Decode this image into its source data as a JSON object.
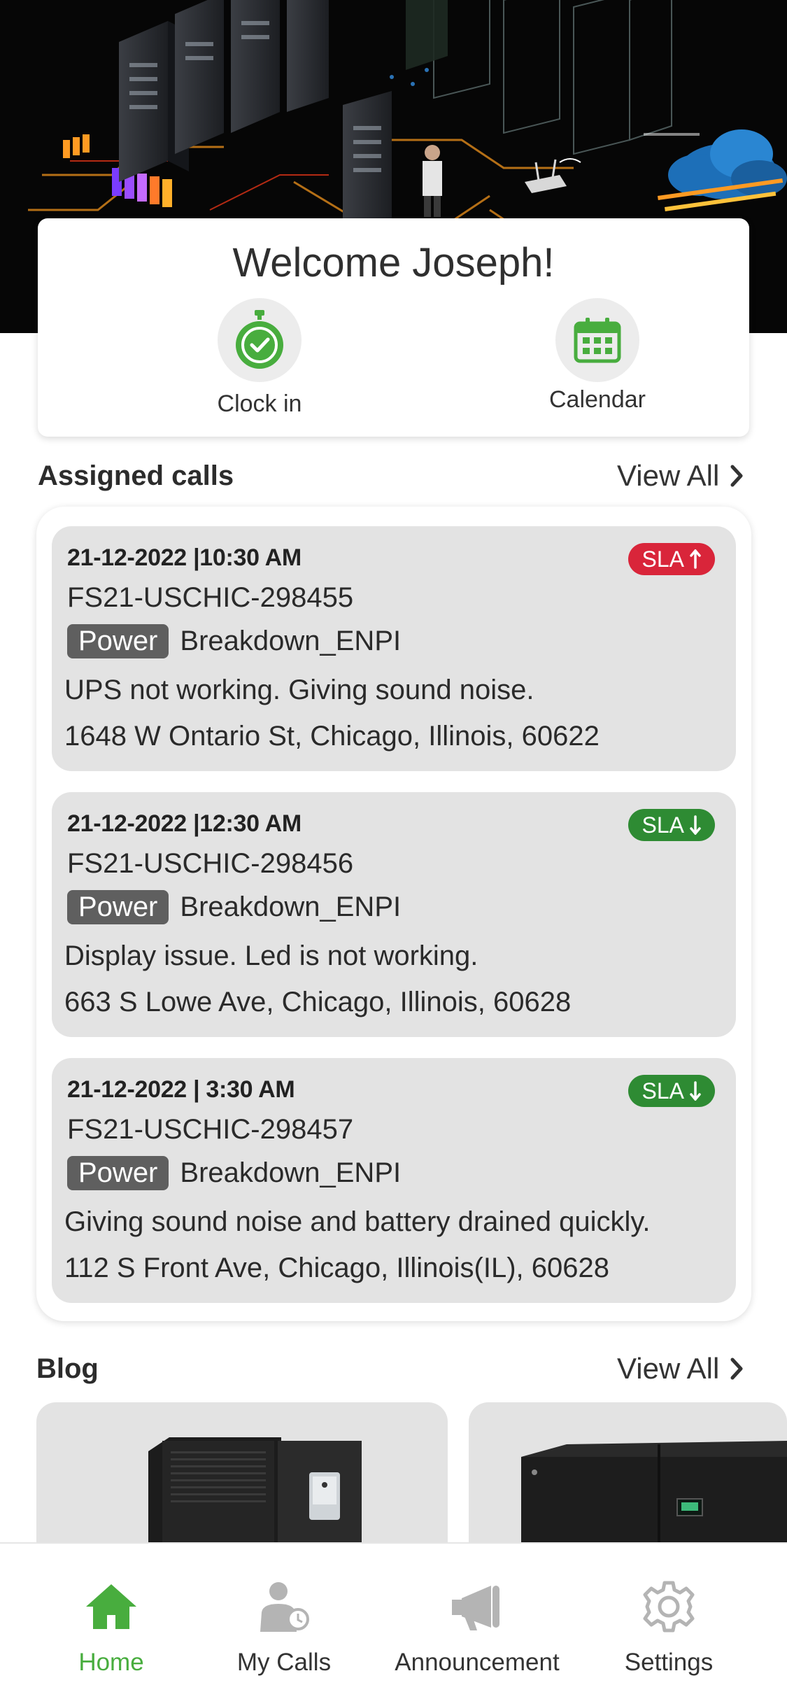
{
  "welcome": {
    "title": "Welcome Joseph!",
    "actions": [
      {
        "label": "Clock in",
        "icon": "stopwatch-check-icon"
      },
      {
        "label": "Calendar",
        "icon": "calendar-icon"
      }
    ]
  },
  "assigned_calls": {
    "title": "Assigned calls",
    "view_all": "View All",
    "calls": [
      {
        "datetime": "21-12-2022 |10:30 AM",
        "id": "FS21-USCHIC-298455",
        "type": "Power",
        "category": "Breakdown_ENPI",
        "description": "UPS not working. Giving sound noise.",
        "address": "1648 W Ontario St, Chicago, Illinois, 60622",
        "sla": "SLA",
        "sla_direction": "up",
        "sla_color": "#d9253a"
      },
      {
        "datetime": "21-12-2022 |12:30 AM",
        "id": "FS21-USCHIC-298456",
        "type": "Power",
        "category": "Breakdown_ENPI",
        "description": "Display issue. Led is not working.",
        "address": "663 S Lowe Ave, Chicago, Illinois, 60628",
        "sla": "SLA",
        "sla_direction": "down",
        "sla_color": "#2e8b33"
      },
      {
        "datetime": "21-12-2022 | 3:30 AM",
        "id": "FS21-USCHIC-298457",
        "type": "Power",
        "category": "Breakdown_ENPI",
        "description": "Giving sound noise and battery drained quickly.",
        "address": "112 S Front Ave, Chicago, Illinois(IL), 60628",
        "sla": "SLA",
        "sla_direction": "down",
        "sla_color": "#2e8b33"
      }
    ]
  },
  "blog": {
    "title": "Blog",
    "view_all": "View All"
  },
  "bottom_nav": [
    {
      "label": "Home",
      "icon": "home-icon",
      "active": true
    },
    {
      "label": "My Calls",
      "icon": "technician-clock-icon",
      "active": false
    },
    {
      "label": "Announcement",
      "icon": "megaphone-icon",
      "active": false
    },
    {
      "label": "Settings",
      "icon": "gear-icon",
      "active": false
    }
  ],
  "colors": {
    "accent_green": "#48ad3e",
    "sla_up": "#d9253a",
    "sla_down": "#2e8b33",
    "card_bg": "#e3e3e3"
  }
}
